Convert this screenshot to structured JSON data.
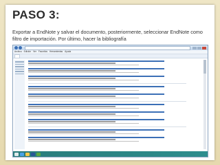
{
  "slide": {
    "title": "PASO 3:",
    "description": "Exportar a EndNote y salvar el documento, posteriormente, seleccionar EndNote como filtro de importación. Por último, hacer la bibliografía"
  },
  "screenshot": {
    "menu": [
      "Archivo",
      "Edición",
      "Ver",
      "Favoritos",
      "Herramientas",
      "Ayuda"
    ]
  },
  "icons": [
    "back-icon",
    "forward-icon",
    "start-icon",
    "ie-icon",
    "folder-icon",
    "word-icon",
    "endnote-icon"
  ]
}
